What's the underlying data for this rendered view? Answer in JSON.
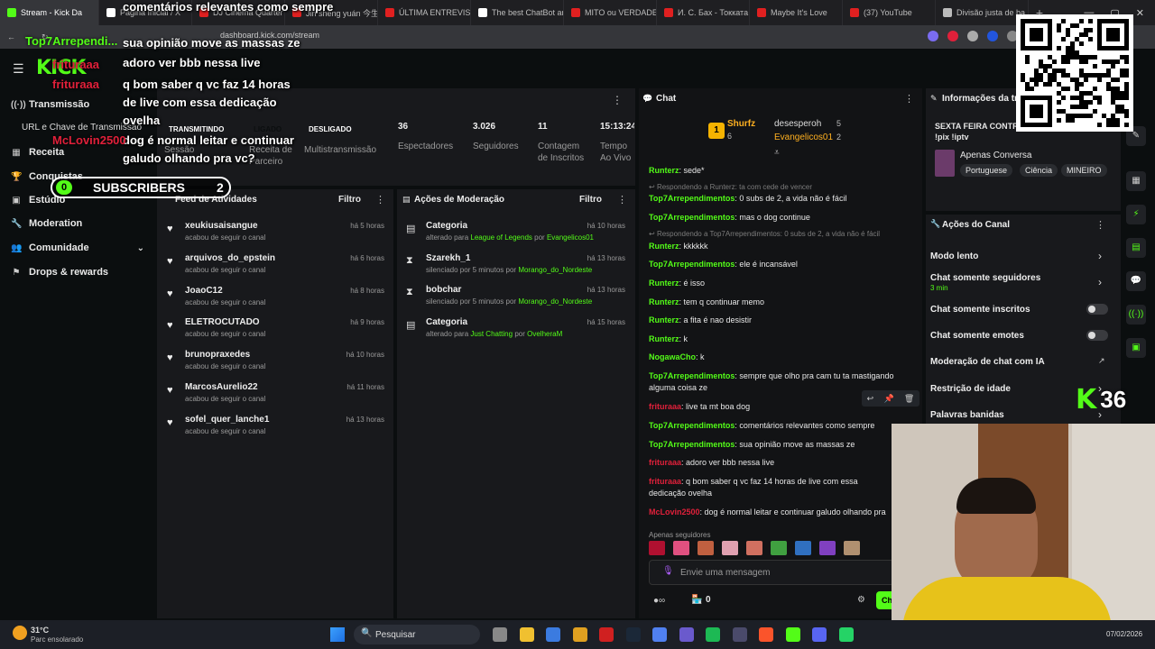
{
  "browser": {
    "tabs": [
      {
        "label": "Stream - Kick Da",
        "color": "#53fc18"
      },
      {
        "label": "Página Inicial / X",
        "color": "#ffffff"
      },
      {
        "label": "DJ Cinema Quarter",
        "color": "#e02020"
      },
      {
        "label": "Jin shēng yuán 今生",
        "color": "#e02020"
      },
      {
        "label": "ÚLTIMA ENTREVIST",
        "color": "#e02020"
      },
      {
        "label": "The best ChatBot ar",
        "color": "#ffffff"
      },
      {
        "label": "MITO ou VERDADE",
        "color": "#e02020"
      },
      {
        "label": "И. С. Бах - Токката",
        "color": "#e02020"
      },
      {
        "label": "Maybe It's Love",
        "color": "#e02020"
      },
      {
        "label": "(37) YouTube",
        "color": "#e02020"
      },
      {
        "label": "Divisão justa de ba",
        "color": "#bbbbbb"
      }
    ],
    "url": "dashboard.kick.com/stream"
  },
  "sidebar": {
    "items": [
      {
        "label": "Transmissão",
        "icon": "broadcast-icon"
      },
      {
        "label": "URL e Chave de Transmissão"
      },
      {
        "label": "Receita",
        "icon": "revenue-icon"
      },
      {
        "label": "Conquistas",
        "icon": "trophy-icon"
      },
      {
        "label": "Estúdio",
        "icon": "studio-icon"
      },
      {
        "label": "Moderation",
        "icon": "wrench-icon"
      },
      {
        "label": "Comunidade",
        "icon": "people-icon"
      },
      {
        "label": "Drops & rewards",
        "icon": "drops-icon"
      }
    ]
  },
  "status": {
    "badges": [
      {
        "label": "TRANSMITINDO",
        "color": "#e0203a",
        "caption": "Sessão"
      },
      {
        "label": "LIGADO",
        "color": "#53fc18",
        "caption": "Receita de Parceiro"
      },
      {
        "label": "DESLIGADO",
        "color": "#e0203a",
        "caption": "Multistransmissão"
      }
    ],
    "stats": [
      {
        "value": "36",
        "label": "Espectadores"
      },
      {
        "value": "3.026",
        "label": "Seguidores"
      },
      {
        "value": "11",
        "label": "Contagem de Inscritos"
      },
      {
        "value": "15:13:24",
        "label": "Tempo Ao Vivo"
      }
    ]
  },
  "feed": {
    "title": "Feed de Atividades",
    "filter": "Filtro",
    "rows": [
      {
        "name": "xeukiusaisangue",
        "sub": "acabou de seguir o canal",
        "time": "há 5 horas"
      },
      {
        "name": "arquivos_do_epstein",
        "sub": "acabou de seguir o canal",
        "time": "há 6 horas"
      },
      {
        "name": "JoaoC12",
        "sub": "acabou de seguir o canal",
        "time": "há 8 horas"
      },
      {
        "name": "ELETROCUTADO",
        "sub": "acabou de seguir o canal",
        "time": "há 9 horas"
      },
      {
        "name": "brunopraxedes",
        "sub": "acabou de seguir o canal",
        "time": "há 10 horas"
      },
      {
        "name": "MarcosAurelio22",
        "sub": "acabou de seguir o canal",
        "time": "há 11 horas"
      },
      {
        "name": "sofel_quer_lanche1",
        "sub": "acabou de seguir o canal",
        "time": "há 13 horas"
      }
    ]
  },
  "moderation": {
    "title": "Ações de Moderação",
    "filter": "Filtro",
    "rows": [
      {
        "name": "Categoria",
        "icon": "category-icon",
        "pre": "alterado para",
        "target": "League of Legends",
        "mid": "por",
        "by": "Evangelicos01",
        "time": "há 10 horas"
      },
      {
        "name": "Szarekh_1",
        "icon": "hourglass-icon",
        "pre": "silenciado por 5 minutos",
        "target": "",
        "mid": "por",
        "by": "Morango_do_Nordeste",
        "time": "há 13 horas"
      },
      {
        "name": "bobchar",
        "icon": "hourglass-icon",
        "pre": "silenciado por 5 minutos",
        "target": "",
        "mid": "por",
        "by": "Morango_do_Nordeste",
        "time": "há 13 horas"
      },
      {
        "name": "Categoria",
        "icon": "category-icon",
        "pre": "alterado para",
        "target": "Just Chatting",
        "mid": "por",
        "by": "OvelheraM",
        "time": "há 15 horas"
      }
    ]
  },
  "chat": {
    "title": "Chat",
    "leaders": [
      {
        "name": "Shurfz",
        "count": "6"
      },
      {
        "name": "desesperoh",
        "count": "5"
      },
      {
        "name": "Evangelicos01",
        "count": "2"
      }
    ],
    "messages": [
      {
        "user": "Runterz",
        "text": "sede*",
        "color": "green"
      },
      {
        "reply": "Respondendo a Runterz: ta com cede de vencer"
      },
      {
        "user": "Top7Arrependimentos",
        "text": "0 subs de 2, a vida não é fácil",
        "color": "green"
      },
      {
        "user": "Top7Arrependimentos",
        "text": "mas o dog continue",
        "color": "green"
      },
      {
        "reply": "Respondendo a Top7Arrependimentos: 0 subs de 2, a vida não é fácil"
      },
      {
        "user": "Runterz",
        "text": "kkkkkk",
        "color": "green"
      },
      {
        "user": "Top7Arrependimentos",
        "text": "ele é incansável",
        "color": "green"
      },
      {
        "user": "Runterz",
        "text": "é isso",
        "color": "green"
      },
      {
        "user": "Runterz",
        "text": "tem q continuar memo",
        "color": "green"
      },
      {
        "user": "Runterz",
        "text": "a fita é nao desistir",
        "color": "green"
      },
      {
        "user": "Runterz",
        "text": "k",
        "color": "green"
      },
      {
        "user": "NogawaCho",
        "text": "k",
        "color": "green"
      },
      {
        "user": "Top7Arrependimentos",
        "text": "sempre que olho pra cam tu ta mastigando alguma coisa ze",
        "color": "green"
      },
      {
        "user": "frituraaa",
        "text": "live ta mt boa dog",
        "color": "red"
      },
      {
        "user": "Top7Arrependimentos",
        "text": "comentários relevantes como sempre",
        "color": "green"
      },
      {
        "user": "Top7Arrependimentos",
        "text": "sua opinião move as massas ze",
        "color": "green"
      },
      {
        "user": "frituraaa",
        "text": "adoro ver bbb nessa live",
        "color": "red"
      },
      {
        "user": "frituraaa",
        "text": "q bom saber q vc faz 14 horas de live com essa dedicação ovelha",
        "color": "red"
      },
      {
        "user": "McLovin2500",
        "text": "dog é normal leitar e continuar galudo olhando pra",
        "color": "red"
      }
    ],
    "followers_only": "Apenas seguidores",
    "input_placeholder": "Envie uma mensagem",
    "viewer_count": "0",
    "send_label": "Ch"
  },
  "info": {
    "title": "Informações da transmissão",
    "stream_title": "SEXTA FEIRA CONTRA TUDO E TODOS 😂 !pix !iptv",
    "category": "Apenas Conversa",
    "tags": [
      "Portuguese",
      "Ciência",
      "MINEIRO"
    ]
  },
  "channel_actions": {
    "title": "Ações do Canal",
    "rows": [
      {
        "label": "Modo lento",
        "control": "chevron"
      },
      {
        "label": "Chat somente seguidores",
        "sub": "3 min",
        "control": "chevron"
      },
      {
        "label": "Chat somente inscritos",
        "control": "toggle"
      },
      {
        "label": "Chat somente emotes",
        "control": "toggle"
      },
      {
        "label": "Moderação de chat com IA",
        "control": "external"
      },
      {
        "label": "Restrição de idade",
        "control": "chevron"
      },
      {
        "label": "Palavras banidas",
        "control": "chevron"
      }
    ]
  },
  "overlay": {
    "lines": [
      {
        "user": "Top7Arrependi...",
        "text": "comentários relevantes como sempre"
      },
      {
        "user": "",
        "text": "sua opinião move as massas ze"
      },
      {
        "user": "frituraaa",
        "text": "adoro ver bbb nessa live"
      },
      {
        "user": "frituraaa",
        "text": "q bom saber q vc faz 14 horas de live com essa dedicação ovelha"
      },
      {
        "user": "McLovin2500",
        "text": "dog é normal leitar e continuar galudo olhando pra vc?"
      }
    ],
    "subscribers_label": "SUBSCRIBERS",
    "subscribers_current": "0",
    "subscribers_goal": "2",
    "viewer_badge": "36"
  },
  "taskbar": {
    "weather_temp": "31°C",
    "weather_text": "Parc ensolarado",
    "search_placeholder": "Pesquisar",
    "date": "07/02/2026"
  }
}
